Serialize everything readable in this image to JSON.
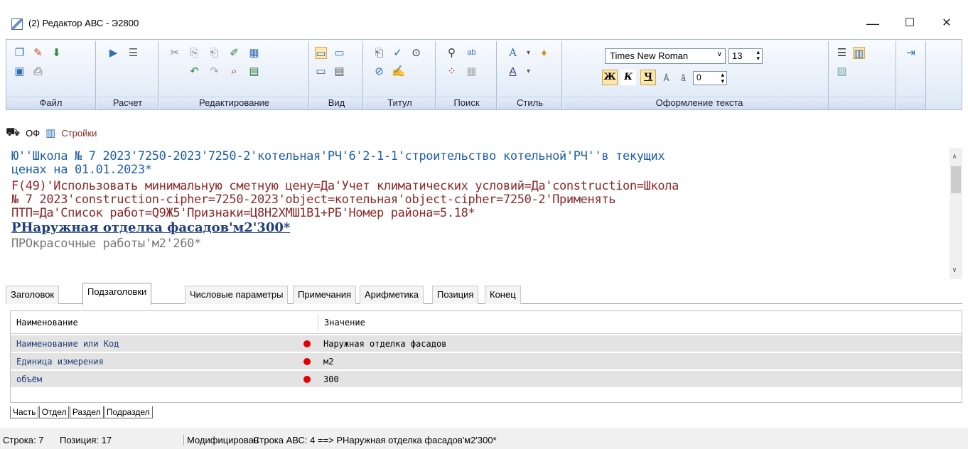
{
  "window": {
    "title": "(2) Редактор АВС - Э2800",
    "minimize": "—",
    "maximize": "☐",
    "close": "✕"
  },
  "ribbon": {
    "groups": [
      {
        "label": "Файл"
      },
      {
        "label": "Расчет"
      },
      {
        "label": "Редактирование"
      },
      {
        "label": "Вид"
      },
      {
        "label": "Титул"
      },
      {
        "label": "Поиск"
      },
      {
        "label": "Стиль"
      },
      {
        "label": "Оформление текста"
      }
    ],
    "font_name": "Times New Roman",
    "font_size": "13",
    "spacing": "0",
    "bold_label": "Ж",
    "italic_label": "К",
    "underline_label": "Ч"
  },
  "subbar": {
    "item1": "ОФ",
    "item2": "Стройки"
  },
  "editor": {
    "lines": [
      "Ю''Школа № 7 2023'7250-2023'7250-2'котельная'РЧ'6'2-1-1'строительство котельной'РЧ''в текущих",
      "ценах на 01.01.2023*",
      "F(49)'Использовать минимальную сметную цену=Да'Учет климатических условий=Да'construction=Школа",
      "№ 7 2023'construction-cipher=7250-2023'object=котельная'object-cipher=7250-2'Применять",
      "ПТП=Да'Список работ=Q9Ж5'Признаки=Ц8Н2ХМШ1В1+РБ'Номер района=5.18*",
      "РНаружная отделка фасадов'м2'300*",
      "ПРОкрасочные работы'м2'260*"
    ]
  },
  "tabs": [
    "Заголовок",
    "Подзаголовки",
    "Числовые параметры",
    "Примечания",
    "Арифметика",
    "Позиция",
    "Конец"
  ],
  "grid": {
    "headers": [
      "Наименование",
      "Значение"
    ],
    "rows": [
      {
        "name": "Наименование или Код",
        "value": "Наружная отделка фасадов"
      },
      {
        "name": "Единица измерения",
        "value": "м2"
      },
      {
        "name": "объём",
        "value": "300"
      }
    ]
  },
  "bottom_tabs": [
    "Часть",
    "Отдел",
    "Раздел",
    "Подраздел"
  ],
  "status": {
    "line": "Строка: 7",
    "position": "Позиция: 17",
    "modified": "Модифицирован",
    "abc": "Строка АВС: 4 ==> РНаружная отделка фасадов'м2'300*"
  },
  "colors": {
    "ribbon_bg": "#dde8f6",
    "editor_blue": "#1f5fa8",
    "editor_red": "#8b2a2a",
    "marker_red": "#e30000"
  }
}
